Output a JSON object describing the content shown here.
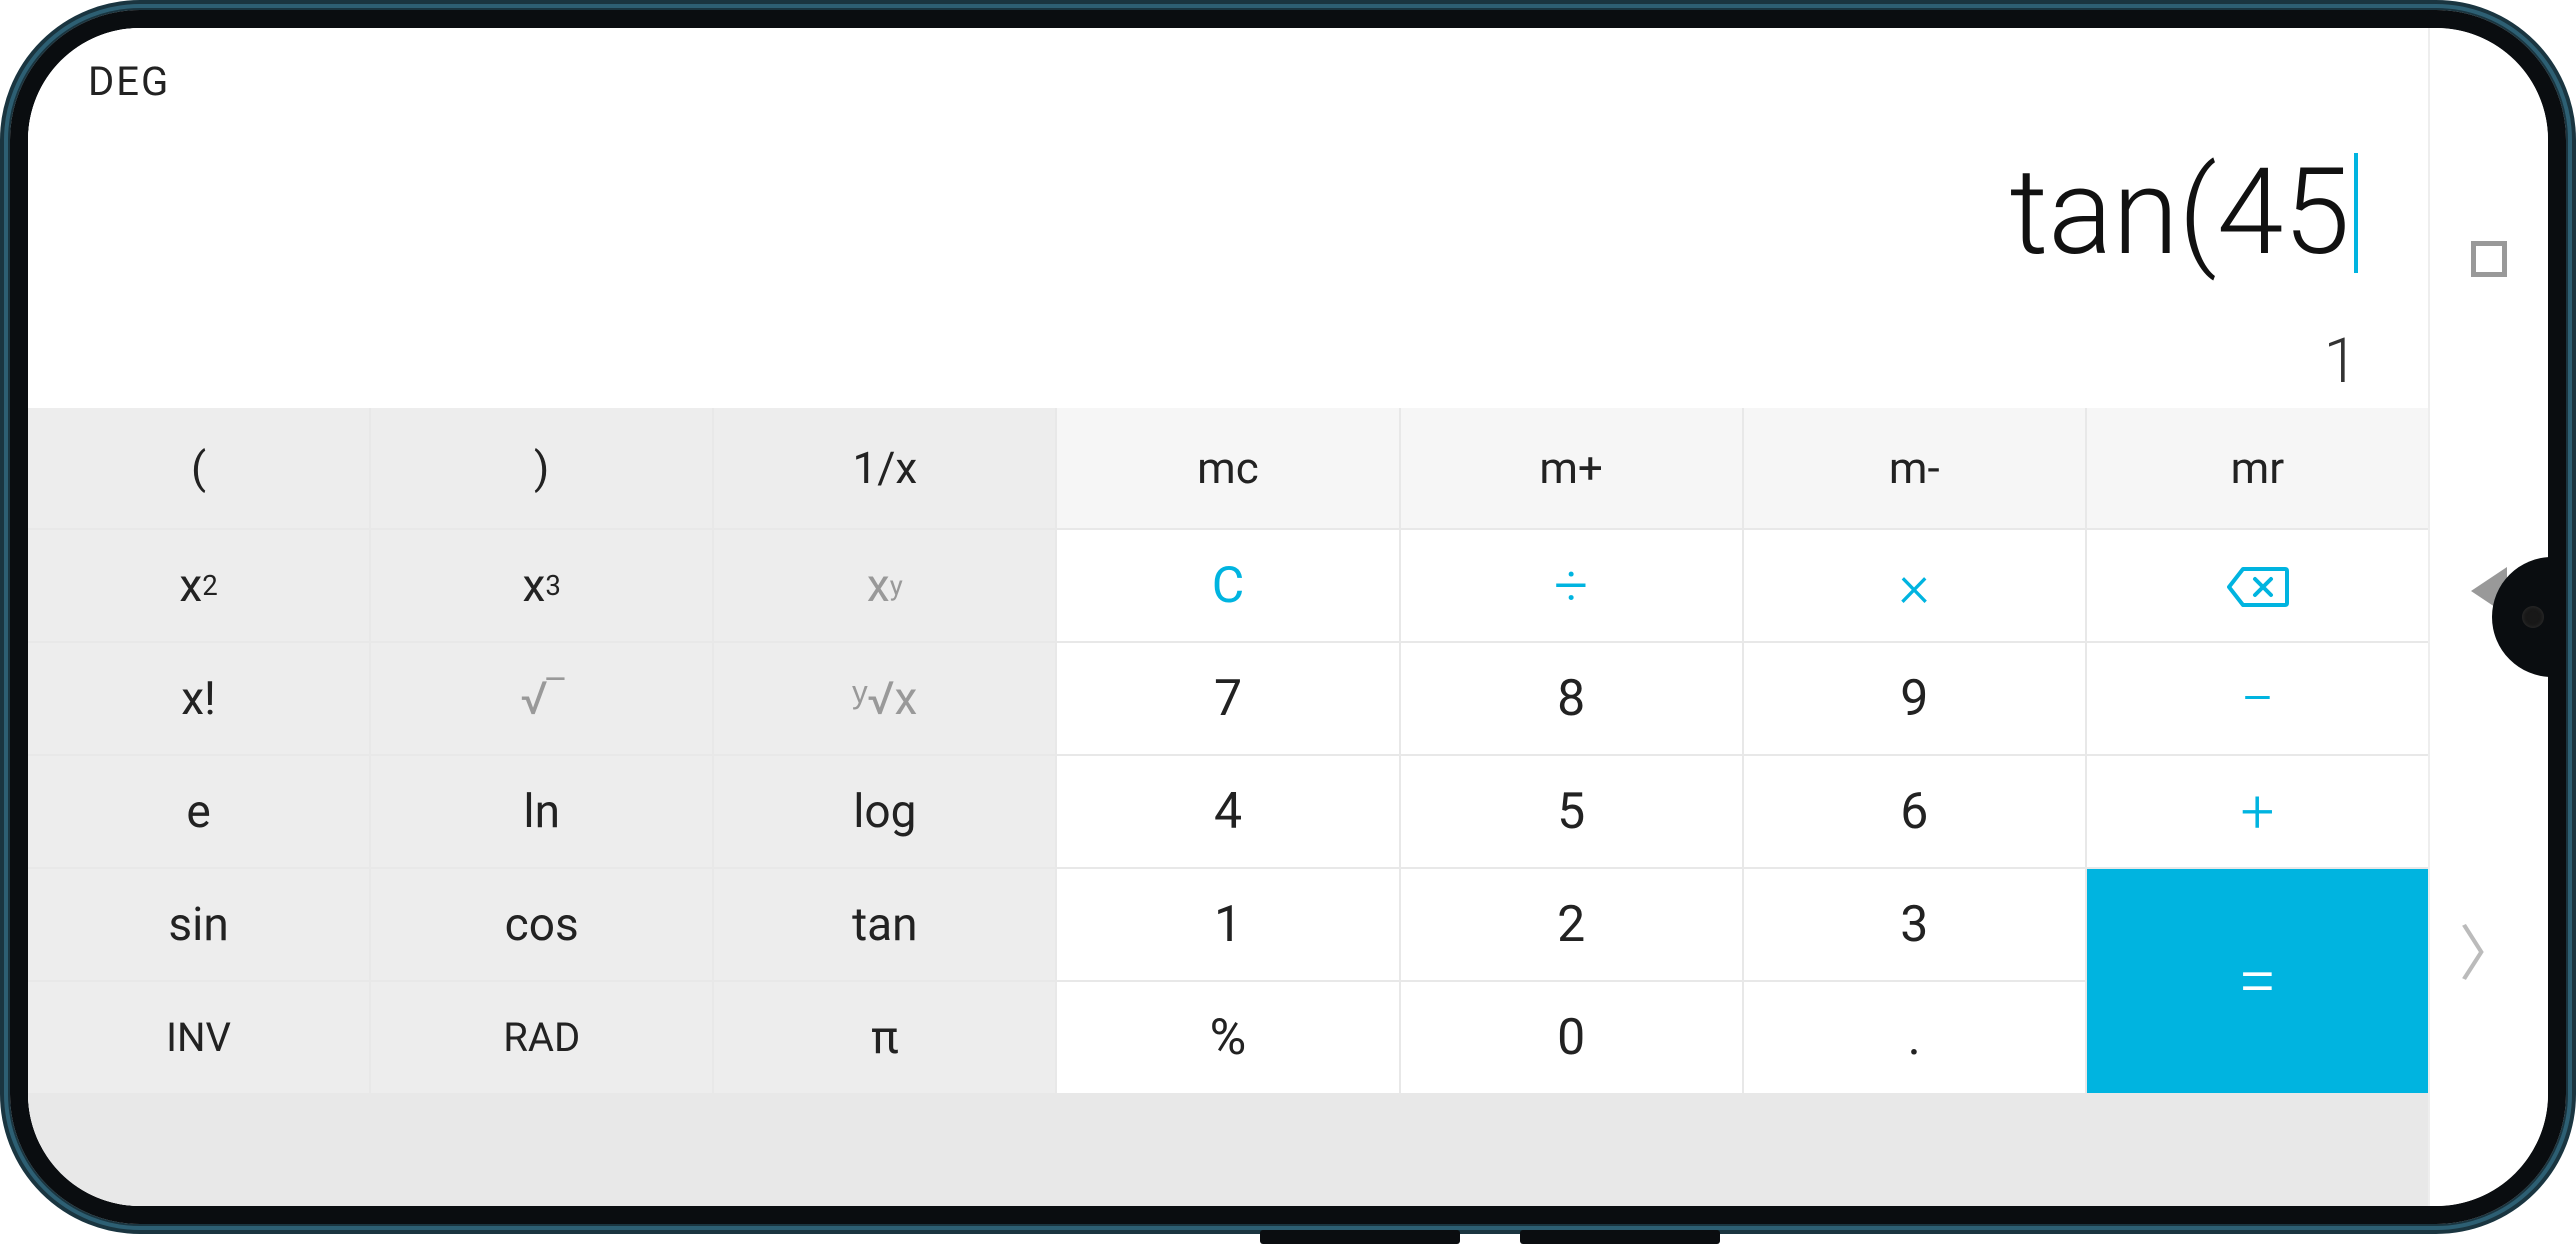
{
  "mode": "DEG",
  "expression": "tan(45",
  "result": "1",
  "accent_color": "#00b4e0",
  "row0": {
    "lparen": "(",
    "rparen": ")",
    "reciprocal": "1/x",
    "mc": "mc",
    "mplus": "m+",
    "mminus": "m-",
    "mr": "mr"
  },
  "row1": {
    "x2_base": "x",
    "x2_sup": "2",
    "x3_base": "x",
    "x3_sup": "3",
    "xy_base": "x",
    "xy_sup": "y",
    "clear": "C",
    "divide": "÷",
    "multiply": "×"
  },
  "row2": {
    "fact": "x!",
    "sqrt": "√‾",
    "yroot": "ʸ√x",
    "d7": "7",
    "d8": "8",
    "d9": "9",
    "minus": "−"
  },
  "row3": {
    "e": "e",
    "ln": "ln",
    "log": "log",
    "d4": "4",
    "d5": "5",
    "d6": "6",
    "plus": "+"
  },
  "row4": {
    "sin": "sin",
    "cos": "cos",
    "tan": "tan",
    "d1": "1",
    "d2": "2",
    "d3": "3"
  },
  "row5": {
    "inv": "INV",
    "rad": "RAD",
    "pi": "π",
    "pct": "%",
    "d0": "0",
    "dot": "."
  },
  "equals": "=",
  "nav_drawer": "〉"
}
